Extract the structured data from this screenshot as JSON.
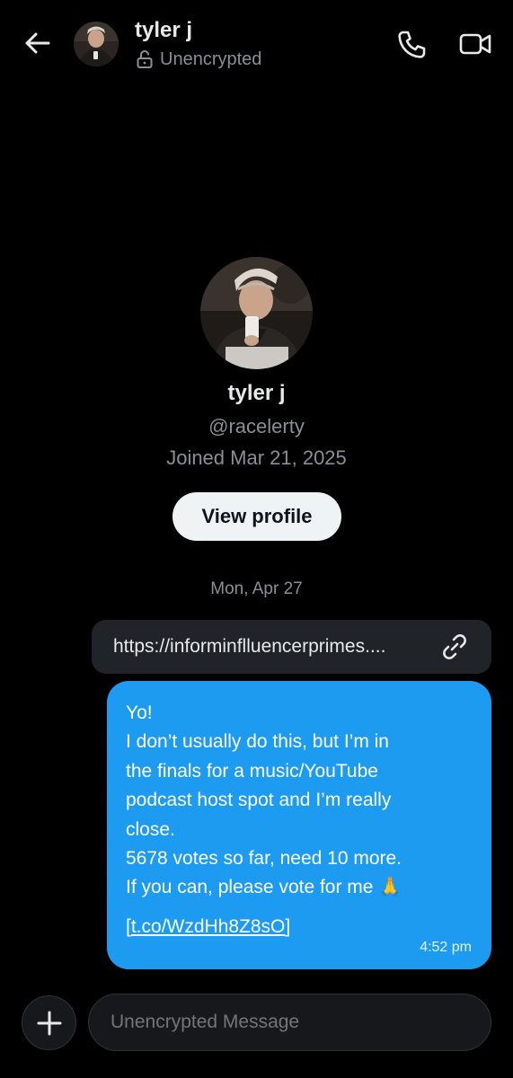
{
  "header": {
    "back_icon": "arrow-left-icon",
    "name": "tyler j",
    "status": "Unencrypted",
    "status_icon": "unlocked-padlock-icon",
    "call_icon": "phone-icon",
    "video_icon": "video-camera-icon"
  },
  "profile": {
    "name": "tyler j",
    "handle": "@racelerty",
    "joined": "Joined Mar 21, 2025",
    "view_profile_label": "View profile"
  },
  "conversation": {
    "date_separator": "Mon, Apr 27",
    "link_preview": {
      "text": "https://informinflluencerprimes....",
      "icon": "link-icon"
    },
    "message": {
      "lines": [
        "Yo!",
        "I don’t usually do this, but I’m in",
        "the finals for a music/YouTube",
        "podcast host spot and I’m really",
        "close.",
        "5678 votes so far, need 10 more.",
        "If you can, please vote for me 🙏"
      ],
      "link_open": "[",
      "link": "t.co/WzdHh8Z8sO",
      "link_close": "]",
      "time": "4:52 pm"
    }
  },
  "composer": {
    "add_icon": "plus-icon",
    "placeholder": "Unencrypted Message"
  },
  "colors": {
    "background": "#000000",
    "bubble_sent": "#1d9bf0",
    "bubble_link": "#202327",
    "muted_text": "#8b8f94",
    "button_bg": "#eff3f4"
  }
}
